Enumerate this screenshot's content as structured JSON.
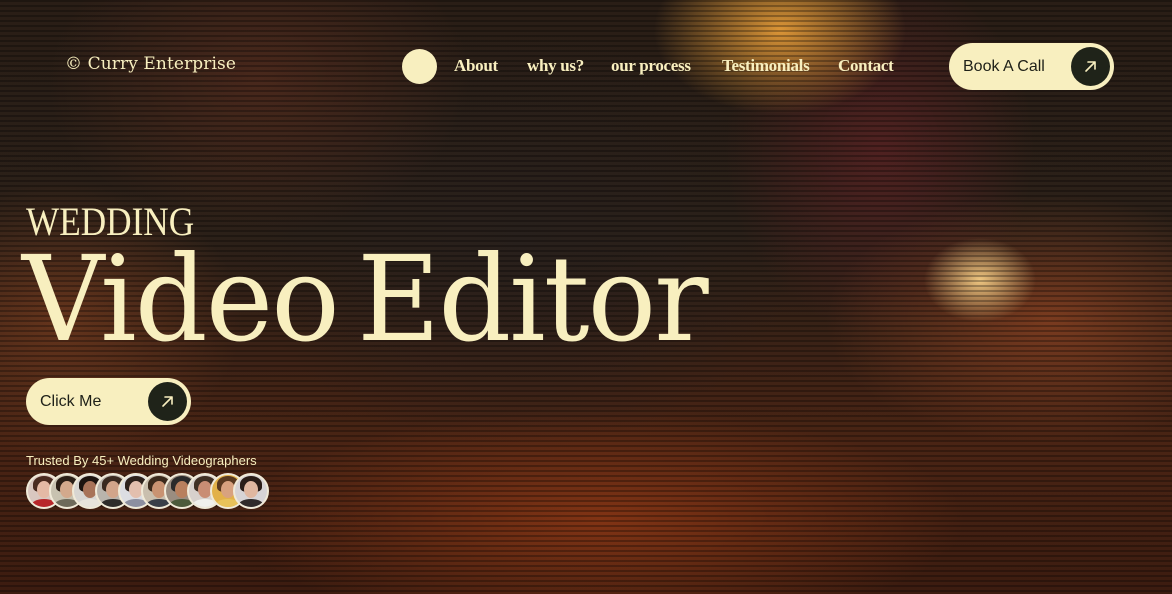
{
  "header": {
    "brand": "© Curry Enterprise",
    "nav": [
      "About",
      "why us?",
      "our process",
      "Testimonials",
      "Contact"
    ],
    "cta_label": "Book A Call"
  },
  "hero": {
    "eyebrow": "WEDDING",
    "title_word1": "Video",
    "title_word2": "Editor",
    "button_label": "Click Me",
    "trusted_text": "Trusted By 45+ Wedding Videographers"
  },
  "icons": {
    "nav_dot": "circle-dot-icon",
    "cta_arrow": "arrow-up-right-icon",
    "button_arrow": "arrow-up-right-icon"
  },
  "colors": {
    "accent_cream": "#f8efbf",
    "dark_circle": "#1f2319",
    "background": "#2a1e16"
  },
  "avatars": [
    {
      "bg": "#d9c7c0",
      "skin": "#e4b9a5",
      "hair": "#4a2b20",
      "top": "#b8272a"
    },
    {
      "bg": "#c8c2b0",
      "skin": "#d3a98c",
      "hair": "#2b1f16",
      "top": "#6e6a5a"
    },
    {
      "bg": "#d8d6d2",
      "skin": "#a87358",
      "hair": "#1d140f",
      "top": "#e8e4dc"
    },
    {
      "bg": "#b9b4ac",
      "skin": "#d2a58a",
      "hair": "#3a2a20",
      "top": "#2f2c2a"
    },
    {
      "bg": "#dcdde2",
      "skin": "#e3bfae",
      "hair": "#2e221c",
      "top": "#8c8fa0"
    },
    {
      "bg": "#c9bfae",
      "skin": "#c99372",
      "hair": "#3b2a1c",
      "top": "#3a3f48"
    },
    {
      "bg": "#9a8d80",
      "skin": "#b8805e",
      "hair": "#2a2a2a",
      "top": "#4d5a3b"
    },
    {
      "bg": "#d7d0cc",
      "skin": "#c98d74",
      "hair": "#403024",
      "top": "#f1f0ec"
    },
    {
      "bg": "#e2b14a",
      "skin": "#d8a27f",
      "hair": "#5a3a20",
      "top": "#e8c25a"
    },
    {
      "bg": "#d7d4d6",
      "skin": "#e0b7a0",
      "hair": "#2a1d18",
      "top": "#2f2a2a"
    }
  ]
}
